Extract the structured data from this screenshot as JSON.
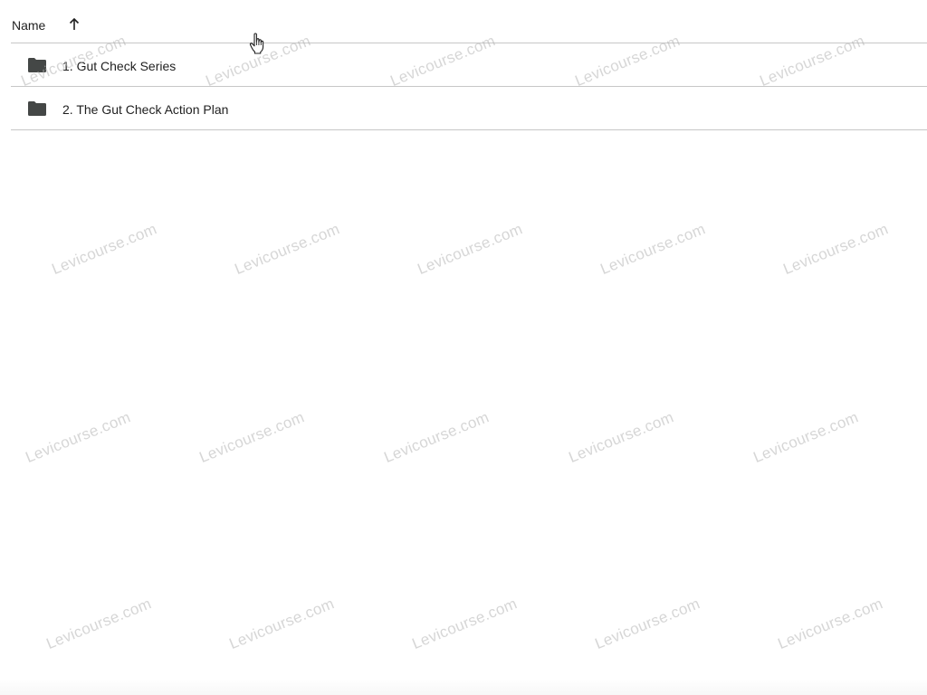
{
  "list": {
    "header": {
      "name_label": "Name",
      "sort_icon": "arrow-up-icon"
    },
    "rows": [
      {
        "icon": "folder-icon",
        "name": "1. Gut Check Series"
      },
      {
        "icon": "folder-icon",
        "name": "2. The Gut Check Action Plan"
      }
    ]
  },
  "watermark": {
    "text": "Levicourse.com"
  },
  "colors": {
    "divider": "#c7c7c7",
    "folder": "#444746",
    "text": "#1f1f1f",
    "watermark": "#b4b4b4"
  }
}
